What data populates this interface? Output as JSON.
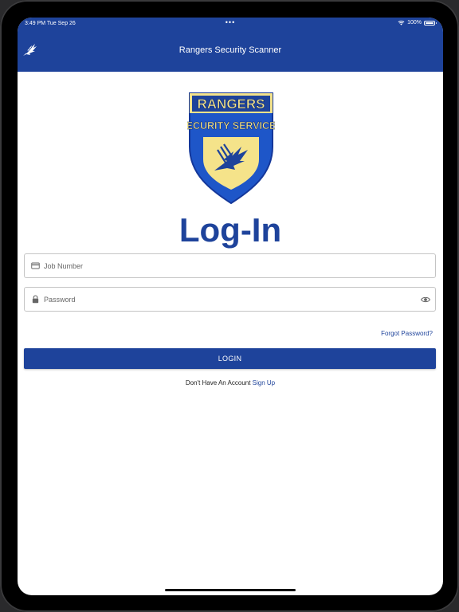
{
  "status_bar": {
    "time": "3:49 PM  Tue Sep 26",
    "dots": "•••",
    "battery": "100%"
  },
  "navbar": {
    "title": "Rangers Security Scanner",
    "logo_icon": "eagle-logo-icon"
  },
  "brand": {
    "badge_top_text": "RANGERS",
    "badge_bottom_text": "SECURITY SERVICES",
    "primary_color": "#1e439b",
    "accent_color": "#f5e38a"
  },
  "login_form": {
    "heading": "Log-In",
    "job_number_placeholder": "Job Number",
    "job_number_value": "",
    "password_placeholder": "Password",
    "password_value": "",
    "forgot_password_label": "Forgot Password?",
    "login_button_label": "LOGIN",
    "no_account_text": "Don't Have An Account",
    "sign_up_label": "Sign Up"
  }
}
